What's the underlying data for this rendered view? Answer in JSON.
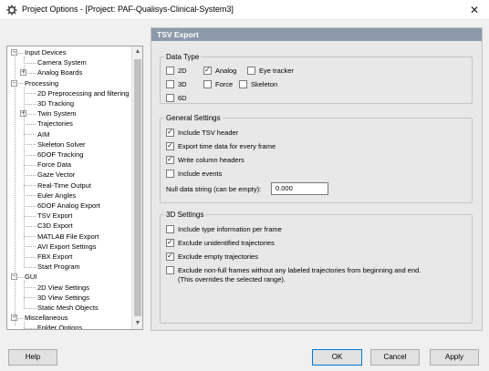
{
  "window": {
    "title": "Project Options - [Project: PAF-Qualisys-Clinical-System3]",
    "app_icon": "gear-icon",
    "close_label": "✕"
  },
  "tree": {
    "items": [
      {
        "label": "Input Devices",
        "level": 0,
        "expander": "−"
      },
      {
        "label": "Camera System",
        "level": 1
      },
      {
        "label": "Analog Boards",
        "level": 1,
        "expander": "+"
      },
      {
        "label": "Processing",
        "level": 0,
        "expander": "−"
      },
      {
        "label": "2D Preprocessing and filtering",
        "level": 1
      },
      {
        "label": "3D Tracking",
        "level": 1
      },
      {
        "label": "Twin System",
        "level": 1,
        "expander": "+"
      },
      {
        "label": "Trajectories",
        "level": 1
      },
      {
        "label": "AIM",
        "level": 1
      },
      {
        "label": "Skeleton Solver",
        "level": 1
      },
      {
        "label": "6DOF Tracking",
        "level": 1
      },
      {
        "label": "Force Data",
        "level": 1
      },
      {
        "label": "Gaze Vector",
        "level": 1
      },
      {
        "label": "Real-Time Output",
        "level": 1
      },
      {
        "label": "Euler Angles",
        "level": 1
      },
      {
        "label": "6DOF Analog Export",
        "level": 1
      },
      {
        "label": "TSV Export",
        "level": 1,
        "selected": true
      },
      {
        "label": "C3D Export",
        "level": 1
      },
      {
        "label": "MATLAB File Export",
        "level": 1
      },
      {
        "label": "AVI Export Settings",
        "level": 1
      },
      {
        "label": "FBX Export",
        "level": 1
      },
      {
        "label": "Start Program",
        "level": 1
      },
      {
        "label": "GUI",
        "level": 0,
        "expander": "−"
      },
      {
        "label": "2D View Settings",
        "level": 1
      },
      {
        "label": "3D View Settings",
        "level": 1
      },
      {
        "label": "Static Mesh Objects",
        "level": 1
      },
      {
        "label": "Miscellaneous",
        "level": 0,
        "expander": "−"
      },
      {
        "label": "Folder Options",
        "level": 1
      }
    ],
    "scroll_up": "▲",
    "scroll_down": "▼"
  },
  "panel": {
    "header": "TSV Export",
    "data_type": {
      "title": "Data Type",
      "options": [
        {
          "label": "2D",
          "checked": false
        },
        {
          "label": "Analog",
          "checked": true
        },
        {
          "label": "Eye tracker",
          "checked": false
        },
        {
          "label": "3D",
          "checked": false
        },
        {
          "label": "Force",
          "checked": false
        },
        {
          "label": "Skeleton",
          "checked": false
        },
        {
          "label": "6D",
          "checked": false
        }
      ]
    },
    "general": {
      "title": "General Settings",
      "options": [
        {
          "label": "Include TSV header",
          "checked": true
        },
        {
          "label": "Export time data for every frame",
          "checked": true
        },
        {
          "label": "Write column headers",
          "checked": true
        },
        {
          "label": "Include events",
          "checked": false
        }
      ],
      "null_label": "Null data string (can be empty):",
      "null_value": "0.000"
    },
    "settings3d": {
      "title": "3D Settings",
      "options": [
        {
          "label": "Include type information per frame",
          "checked": false
        },
        {
          "label": "Exclude unidentified trajectories",
          "checked": true
        },
        {
          "label": "Exclude empty trajectories",
          "checked": true
        },
        {
          "label": "Exclude non-full frames without any labeled trajectories from beginning and end.",
          "label2": "(This overrides the selected range).",
          "checked": false
        }
      ]
    }
  },
  "buttons": {
    "help": "Help",
    "ok": "OK",
    "cancel": "Cancel",
    "apply": "Apply"
  },
  "check_mark": "✓"
}
